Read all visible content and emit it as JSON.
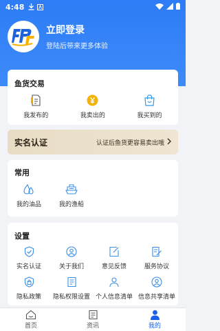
{
  "status_bar": {
    "time": "4:48"
  },
  "profile": {
    "title": "立即登录",
    "subtitle": "登陆后带来更多体验"
  },
  "fish_trade": {
    "title": "鱼货交易",
    "items": [
      {
        "label": "我发布的",
        "icon": "doc-icon"
      },
      {
        "label": "我卖出的",
        "icon": "coin-icon"
      },
      {
        "label": "我买到的",
        "icon": "shopping-bag-icon"
      }
    ]
  },
  "auth_banner": {
    "title": "实名认证",
    "hint": "认证后鱼货更容易卖出哦"
  },
  "common": {
    "title": "常用",
    "items": [
      {
        "label": "我的油品",
        "icon": "oil-drop-icon"
      },
      {
        "label": "我的渔船",
        "icon": "boat-icon"
      }
    ]
  },
  "settings": {
    "title": "设置",
    "items": [
      {
        "label": "实名认证",
        "icon": "shield-check-icon"
      },
      {
        "label": "关于我们",
        "icon": "user-circle-icon"
      },
      {
        "label": "意见反馈",
        "icon": "edit-icon"
      },
      {
        "label": "服务协议",
        "icon": "agreement-icon"
      },
      {
        "label": "隐私政策",
        "icon": "lock-icon"
      },
      {
        "label": "隐私权限设置",
        "icon": "settings-doc-icon"
      },
      {
        "label": "个人信息清单",
        "icon": "person-list-icon"
      },
      {
        "label": "信息共享清单",
        "icon": "share-list-icon"
      }
    ]
  },
  "tabbar": {
    "items": [
      {
        "label": "首页",
        "icon": "home-icon",
        "active": false
      },
      {
        "label": "资讯",
        "icon": "news-icon",
        "active": false
      },
      {
        "label": "我的",
        "icon": "profile-icon",
        "active": true
      }
    ]
  },
  "colors": {
    "brand": "#2e7cf6",
    "accent_gold": "#f5b301",
    "active_tab": "#1a5fe8"
  }
}
